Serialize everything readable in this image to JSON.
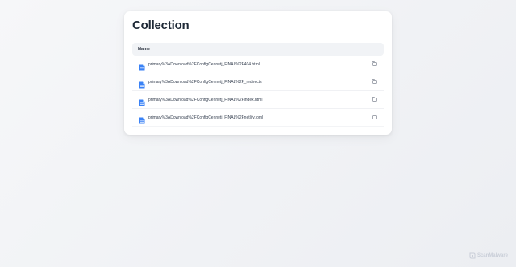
{
  "page": {
    "title": "Collection"
  },
  "table": {
    "header": "Name",
    "files": [
      {
        "name": "primary%3ADownload%2FConfigCennetj_FINAL%2F404.html",
        "icon": "file-icon",
        "action_icon": "copy-icon"
      },
      {
        "name": "primary%3ADownload%2FConfigCennetj_FINAL%2F_redirects",
        "icon": "file-icon",
        "action_icon": "copy-icon"
      },
      {
        "name": "primary%3ADownload%2FConfigCennetj_FINAL%2Findex.html",
        "icon": "file-icon",
        "action_icon": "copy-icon"
      },
      {
        "name": "primary%3ADownload%2FConfigCennetj_FINAL%2Fnetlify.toml",
        "icon": "file-icon",
        "action_icon": "copy-icon"
      }
    ]
  },
  "brand": {
    "label": "ScanMalware",
    "icon": "scanmalware-logo-icon"
  },
  "colors": {
    "file_icon": "#3b82f6",
    "copy_icon": "#6b7280",
    "brand": "#c9ced8"
  }
}
